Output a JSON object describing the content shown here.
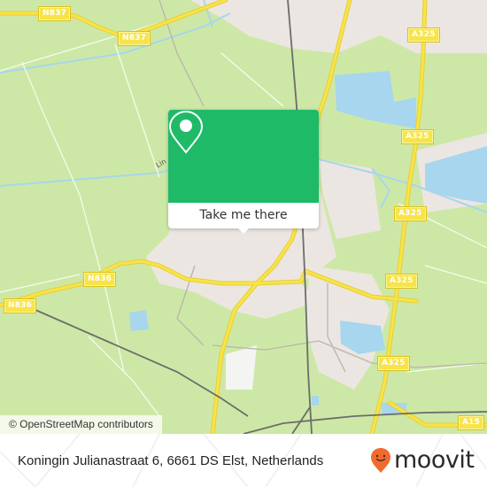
{
  "map": {
    "colors": {
      "land": "#cde8a6",
      "urban": "#ece6e2",
      "water": "#a7d6ee",
      "highway": "#f7e34a",
      "rail": "#6c6c6c",
      "popup_green": "#1fba68",
      "moovit_orange": "#f26a2e"
    },
    "road_labels": [
      {
        "id": "n837-a",
        "text": "N837"
      },
      {
        "id": "n837-b",
        "text": "N837"
      },
      {
        "id": "a325-a",
        "text": "A325"
      },
      {
        "id": "a325-b",
        "text": "A325"
      },
      {
        "id": "a325-c",
        "text": "A325"
      },
      {
        "id": "a325-d",
        "text": "A325"
      },
      {
        "id": "a325-e",
        "text": "A325"
      },
      {
        "id": "n836-a",
        "text": "N836"
      },
      {
        "id": "n836-b",
        "text": "N836"
      },
      {
        "id": "a15",
        "text": "A15"
      }
    ],
    "place_label": "Lin",
    "attribution": "© OpenStreetMap contributors"
  },
  "popup": {
    "icon": "map-pin-icon",
    "button_label": "Take me there"
  },
  "footer": {
    "address": "Koningin Julianastraat 6, 6661 DS Elst, Netherlands",
    "brand": "moovit",
    "brand_icon": "moovit-pin-smile-icon"
  }
}
